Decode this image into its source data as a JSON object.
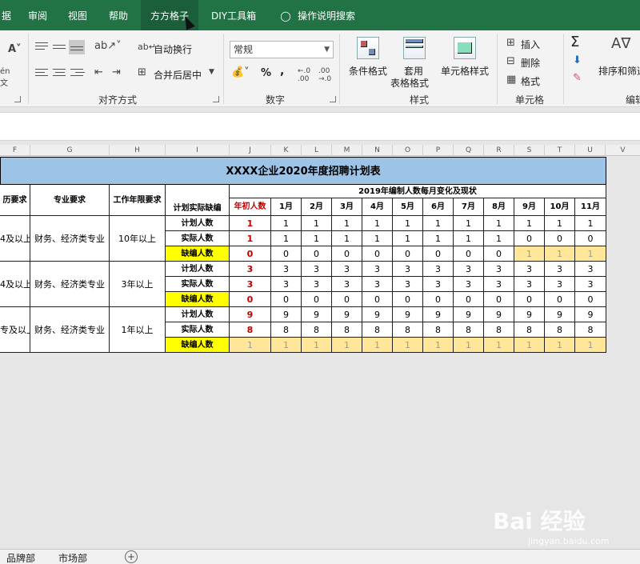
{
  "ribbon_tabs": [
    "据",
    "审阅",
    "视图",
    "帮助",
    "方方格子",
    "DIY工具箱",
    "操作说明搜索"
  ],
  "ribbon": {
    "wrap_text": "自动换行",
    "merge_center": "合并后居中",
    "number_format": "常规",
    "align_group": "对齐方式",
    "number_group": "数字",
    "cond_format": "条件格式",
    "table_format_1": "套用",
    "table_format_2": "表格格式",
    "cell_style": "单元格样式",
    "styles_group": "样式",
    "insert": "插入",
    "delete": "删除",
    "format": "格式",
    "cells_group": "单元格",
    "sort_filter": "排序和筛选",
    "edit_group": "编辑",
    "percent": "%",
    "comma": ",",
    "inc_dec": ".00",
    "sigma": "Σ"
  },
  "columns": [
    "F",
    "G",
    "H",
    "I",
    "J",
    "K",
    "L",
    "M",
    "N",
    "O",
    "P",
    "Q",
    "R",
    "S",
    "T",
    "U",
    "V"
  ],
  "table": {
    "title": "XXXX企业2020年度招聘计划表",
    "col_edu": "历要求",
    "col_major": "专业要求",
    "col_years": "工作年限要求",
    "col_plan_actual": "计划实际缺编",
    "col_initial": "年初人数",
    "months_header": "2019年编制人数每月变化及现状",
    "months": [
      "1月",
      "2月",
      "3月",
      "4月",
      "5月",
      "6月",
      "7月",
      "8月",
      "9月",
      "10月",
      "11月"
    ],
    "groups": [
      {
        "edu": "4及以上",
        "major": "财务、经济类专业",
        "years": "10年以上",
        "rows": [
          {
            "label": "计划人数",
            "initial": "1",
            "values": [
              "1",
              "1",
              "1",
              "1",
              "1",
              "1",
              "1",
              "1",
              "1",
              "1",
              "1"
            ]
          },
          {
            "label": "实际人数",
            "initial": "1",
            "values": [
              "1",
              "1",
              "1",
              "1",
              "1",
              "1",
              "1",
              "1",
              "0",
              "0",
              "0"
            ]
          },
          {
            "label": "缺编人数",
            "initial": "0",
            "values": [
              "0",
              "0",
              "0",
              "0",
              "0",
              "0",
              "0",
              "0",
              "1",
              "1",
              "1"
            ]
          }
        ]
      },
      {
        "edu": "4及以上",
        "major": "财务、经济类专业",
        "years": "3年以上",
        "rows": [
          {
            "label": "计划人数",
            "initial": "3",
            "values": [
              "3",
              "3",
              "3",
              "3",
              "3",
              "3",
              "3",
              "3",
              "3",
              "3",
              "3"
            ]
          },
          {
            "label": "实际人数",
            "initial": "3",
            "values": [
              "3",
              "3",
              "3",
              "3",
              "3",
              "3",
              "3",
              "3",
              "3",
              "3",
              "3"
            ]
          },
          {
            "label": "缺编人数",
            "initial": "0",
            "values": [
              "0",
              "0",
              "0",
              "0",
              "0",
              "0",
              "0",
              "0",
              "0",
              "0",
              "0"
            ]
          }
        ]
      },
      {
        "edu": "专及以上",
        "major": "财务、经济类专业",
        "years": "1年以上",
        "rows": [
          {
            "label": "计划人数",
            "initial": "9",
            "values": [
              "9",
              "9",
              "9",
              "9",
              "9",
              "9",
              "9",
              "9",
              "9",
              "9",
              "9"
            ]
          },
          {
            "label": "实际人数",
            "initial": "8",
            "values": [
              "8",
              "8",
              "8",
              "8",
              "8",
              "8",
              "8",
              "8",
              "8",
              "8",
              "8"
            ]
          },
          {
            "label": "缺编人数",
            "initial": "1",
            "values": [
              "1",
              "1",
              "1",
              "1",
              "1",
              "1",
              "1",
              "1",
              "1",
              "1",
              "1"
            ]
          }
        ]
      }
    ]
  },
  "sheet_tabs": [
    "品牌部",
    "市场部"
  ],
  "watermark": "Bai 经验",
  "watermark_url": "jingyan.baidu.com"
}
